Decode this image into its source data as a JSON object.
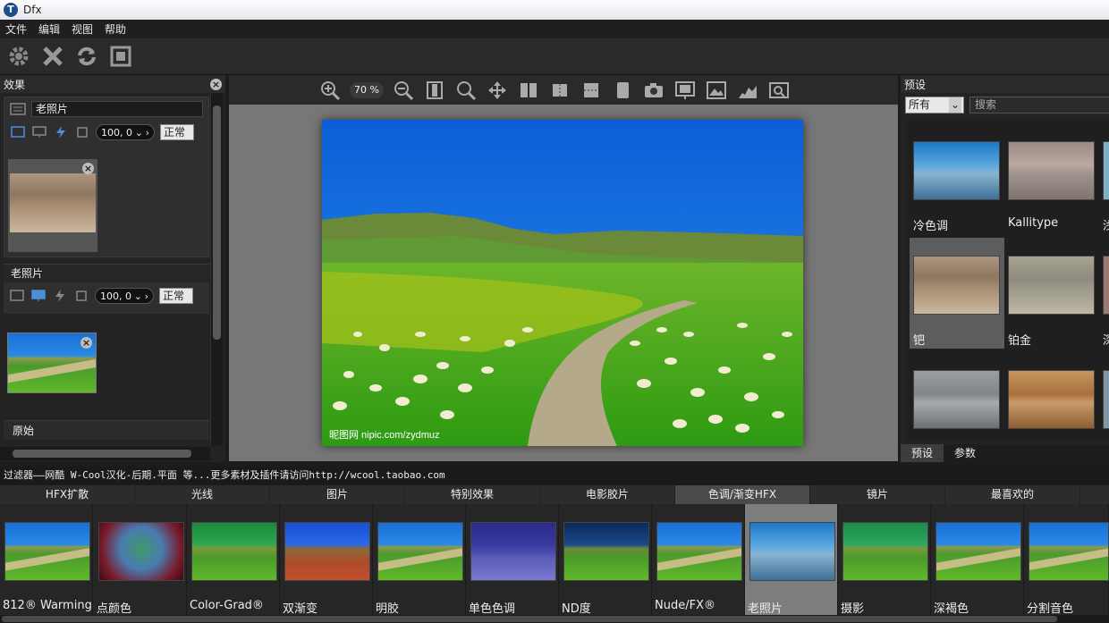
{
  "app": {
    "title": "Dfx"
  },
  "menu": [
    "文件",
    "编辑",
    "视图",
    "帮助"
  ],
  "left_panel": {
    "title": "效果",
    "layers": [
      {
        "name": "老照片",
        "opacity": "100, 0",
        "blend_mode": "正常",
        "thumb_style": "sepia"
      },
      {
        "name": "老照片",
        "opacity": "100, 0",
        "blend_mode": "正常",
        "thumb_style": "color"
      }
    ],
    "original_label": "原始"
  },
  "viewer": {
    "zoom": "70 %",
    "watermark": "昵图网 nipic.com/zydmuz"
  },
  "right_panel": {
    "title": "预设",
    "filter_select": "所有",
    "search_placeholder": "搜索",
    "presets": [
      {
        "label": "冷色调",
        "style": "cool"
      },
      {
        "label": "Kallitype",
        "style": "kallitype"
      },
      {
        "label": "浅",
        "style": "pale"
      },
      {
        "label": "钯",
        "style": "sepia",
        "selected": true
      },
      {
        "label": "铂金",
        "style": "platinum"
      },
      {
        "label": "深",
        "style": "dark"
      },
      {
        "label": "",
        "style": "gray"
      },
      {
        "label": "",
        "style": "warm"
      },
      {
        "label": "",
        "style": "pale"
      }
    ],
    "tabs": [
      "预设",
      "参数"
    ]
  },
  "status_text": "过滤器——网酷 W-Cool汉化-后期.平面 等...更多素材及插件请访问http://wcool.taobao.com",
  "category_tabs": [
    "HFX扩散",
    "光线",
    "图片",
    "特别效果",
    "电影胶片",
    "色调/渐变HFX",
    "镜片",
    "最喜欢的"
  ],
  "active_category": 5,
  "filters": [
    {
      "label": "812® Warming",
      "style": "color"
    },
    {
      "label": "点颜色",
      "style": "vignette"
    },
    {
      "label": "Color-Grad®",
      "style": "green"
    },
    {
      "label": "双渐变",
      "style": "dual"
    },
    {
      "label": "明胶",
      "style": "color"
    },
    {
      "label": "单色色调",
      "style": "mono"
    },
    {
      "label": "ND度",
      "style": "nd"
    },
    {
      "label": "Nude/FX®",
      "style": "color"
    },
    {
      "label": "老照片",
      "style": "cool",
      "active": true
    },
    {
      "label": "摄影",
      "style": "green"
    },
    {
      "label": "深褐色",
      "style": "color"
    },
    {
      "label": "分割音色",
      "style": "color"
    }
  ]
}
